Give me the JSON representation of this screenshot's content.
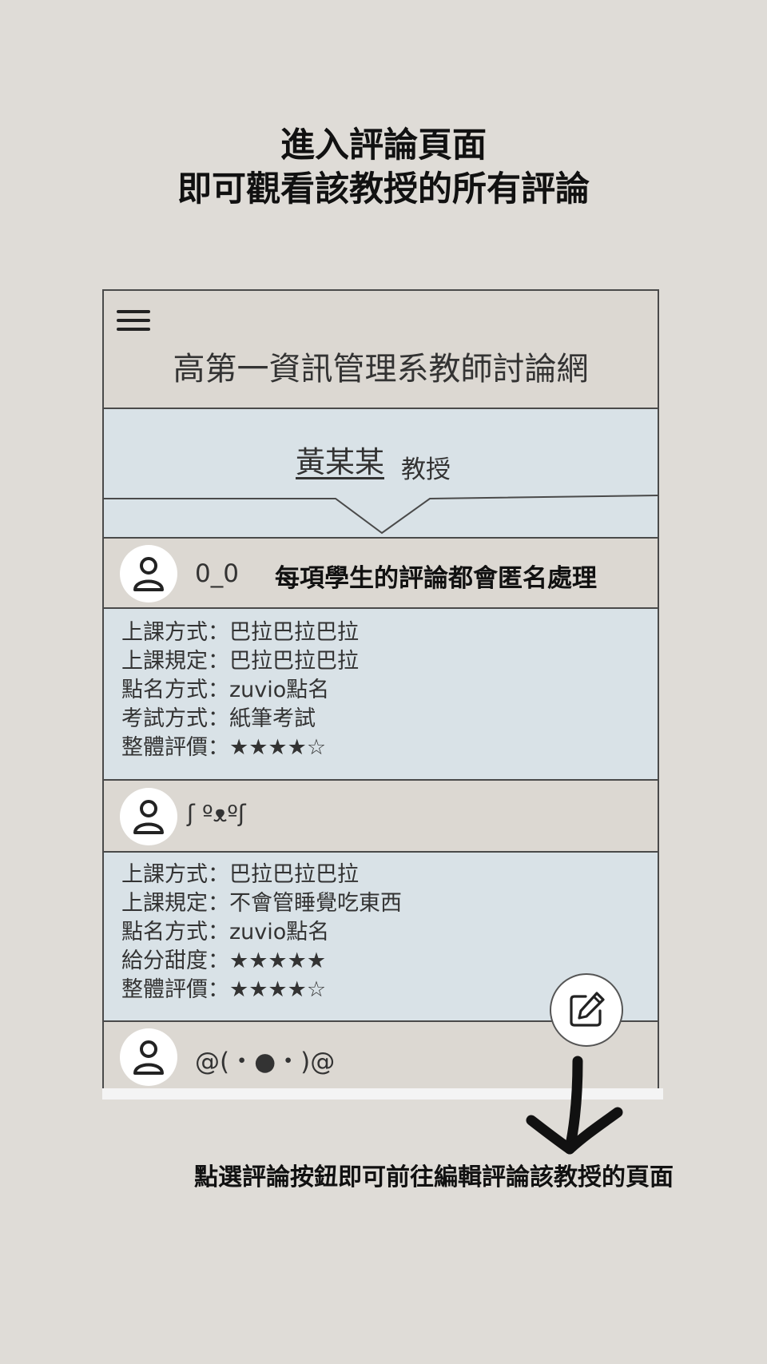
{
  "heading": {
    "line1": "進入評論頁面",
    "line2": "即可觀看該教授的所有評論"
  },
  "app": {
    "menu_icon": "hamburger-menu-icon",
    "title": "高第一資訊管理系教師討論網"
  },
  "professor": {
    "name": "黃某某",
    "title": "教授"
  },
  "anonymous_note": "每項學生的評論都會匿名處理",
  "reviews": [
    {
      "username": "0_0",
      "lines": [
        "上課方式：巴拉巴拉巴拉",
        "上課規定：巴拉巴拉巴拉",
        "點名方式：zuvio點名",
        "考試方式：紙筆考試",
        "整體評價：★★★★☆"
      ]
    },
    {
      "username": "ʃ ºᴥºʃ",
      "lines": [
        "上課方式：巴拉巴拉巴拉",
        "上課規定：不會管睡覺吃東西",
        "點名方式：zuvio點名",
        "給分甜度：★★★★★",
        "整體評價：★★★★☆"
      ]
    },
    {
      "username": "@(・●・)@",
      "lines": []
    }
  ],
  "edit_button_icon": "edit-icon",
  "caption": "點選評論按鈕即可前往編輯評論該教授的頁面",
  "colors": {
    "background": "#dfdcd7",
    "header_bg": "#dcd8d2",
    "review_bg": "#d9e2e7",
    "border": "#4a4a4a"
  }
}
